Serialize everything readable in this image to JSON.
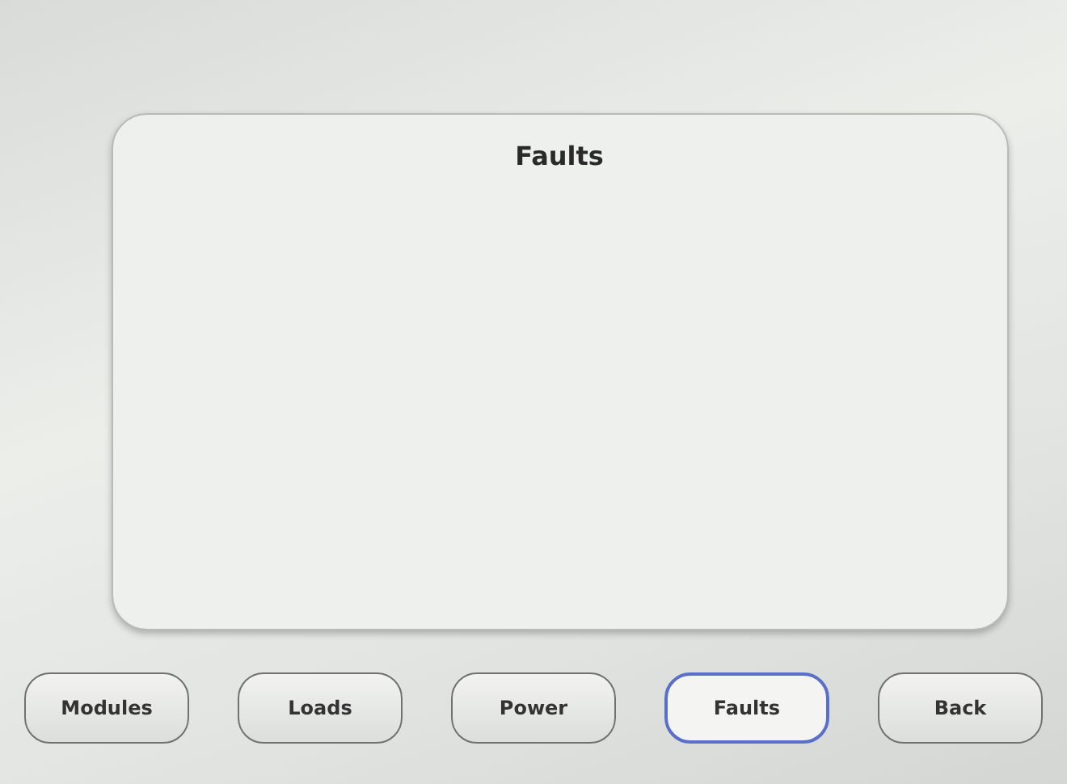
{
  "panel": {
    "title": "Faults"
  },
  "buttons": [
    {
      "label": "Modules",
      "selected": false
    },
    {
      "label": "Loads",
      "selected": false
    },
    {
      "label": "Power",
      "selected": false
    },
    {
      "label": "Faults",
      "selected": true
    },
    {
      "label": "Back",
      "selected": false
    }
  ]
}
